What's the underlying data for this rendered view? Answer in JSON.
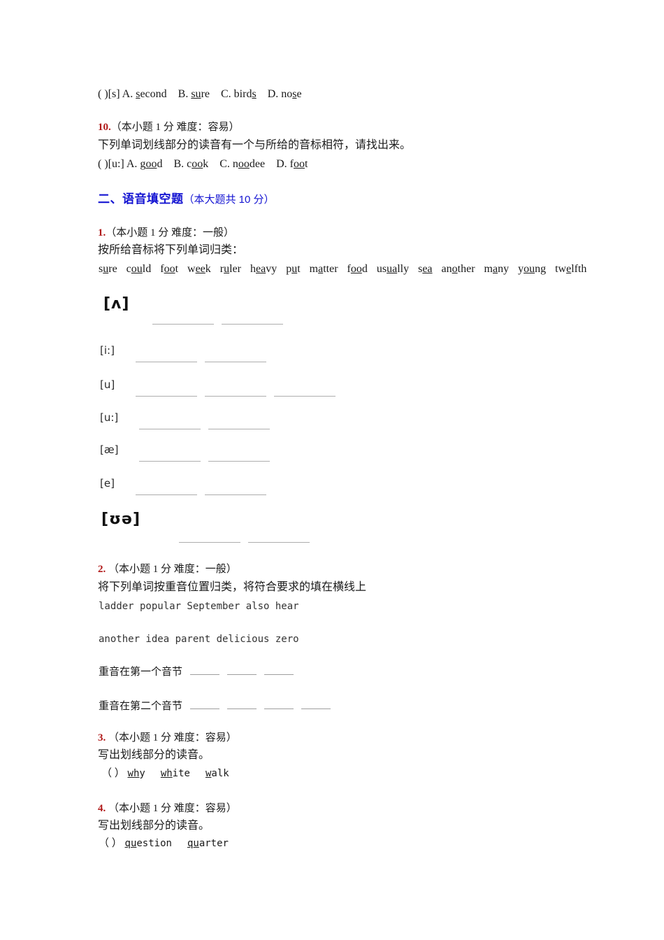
{
  "document": {
    "type": "english-phonetics-worksheet",
    "colors": {
      "question_number": "#b01818",
      "section_heading": "#1414d2",
      "body_text": "#1a1a1a",
      "blank_line": "#adadad"
    }
  },
  "top_choice_line": {
    "bracket": "(      )",
    "phonetic": "[s]",
    "choices": [
      {
        "label": "A.",
        "word_pre": "",
        "word_underlined": "s",
        "word_post": "econd"
      },
      {
        "label": "B.",
        "word_pre": "",
        "word_underlined": "su",
        "word_post": "re"
      },
      {
        "label": "C.",
        "word_pre": "bird",
        "word_underlined": "s",
        "word_post": ""
      },
      {
        "label": "D.",
        "word_pre": "no",
        "word_underlined": "s",
        "word_post": "e"
      }
    ]
  },
  "question_10": {
    "number": "10.",
    "meta": "（本小题 1 分 难度：容易）",
    "stem": "下列单词划线部分的读音有一个与所给的音标相符，请找出来。",
    "bracket": "(     )",
    "phonetic": "[u:]",
    "choices": [
      {
        "label": "A.",
        "word_pre": "g",
        "word_underlined": "oo",
        "word_post": "d"
      },
      {
        "label": "B.",
        "word_pre": "c",
        "word_underlined": "oo",
        "word_post": "k"
      },
      {
        "label": "C.",
        "word_pre": "n",
        "word_underlined": "oo",
        "word_post": "dee"
      },
      {
        "label": "D.",
        "word_pre": "f",
        "word_underlined": "oo",
        "word_post": "t"
      }
    ]
  },
  "section_two": {
    "title": "二、语音填空题",
    "points": "（本大题共 10 分）"
  },
  "question_1": {
    "number": "1.",
    "meta": "（本小题 1 分 难度：一般）",
    "stem": "按所给音标将下列单词归类：",
    "word_bank": [
      {
        "pre": "s",
        "u": "u",
        "post": "re"
      },
      {
        "pre": "c",
        "u": "ou",
        "post": "ld"
      },
      {
        "pre": "f",
        "u": "oo",
        "post": "t"
      },
      {
        "pre": "w",
        "u": "ee",
        "post": "k"
      },
      {
        "pre": "r",
        "u": "u",
        "post": "ler"
      },
      {
        "pre": "h",
        "u": "ea",
        "post": "vy"
      },
      {
        "pre": "p",
        "u": "u",
        "post": "t"
      },
      {
        "pre": "m",
        "u": "a",
        "post": "tter"
      },
      {
        "pre": "f",
        "u": "oo",
        "post": "d"
      },
      {
        "pre": "us",
        "u": "ua",
        "post": "lly"
      },
      {
        "pre": "s",
        "u": "ea",
        "post": ""
      },
      {
        "pre": "an",
        "u": "o",
        "post": "ther"
      },
      {
        "pre": "m",
        "u": "a",
        "post": "ny"
      },
      {
        "pre": "y",
        "u": "ou",
        "post": "ng"
      },
      {
        "pre": "tw",
        "u": "e",
        "post": "lfth"
      }
    ],
    "ipa_groups": [
      {
        "symbol": "[ʌ]",
        "big": true,
        "blanks": 2
      },
      {
        "symbol": "[i:]",
        "big": false,
        "blanks": 2
      },
      {
        "symbol": "[u]",
        "big": false,
        "blanks": 3
      },
      {
        "symbol": "[u:]",
        "big": false,
        "blanks": 2
      },
      {
        "symbol": "[æ]",
        "big": false,
        "blanks": 2
      },
      {
        "symbol": "[e]",
        "big": false,
        "blanks": 2
      },
      {
        "symbol": "[ʊə]",
        "big": true,
        "blanks": 2
      }
    ]
  },
  "question_2": {
    "number": "2.",
    "meta": "（本小题 1 分 难度：一般）",
    "stem": "将下列单词按重音位置归类，将符合要求的填在横线上",
    "word_line_1": "ladder    popular    September also    hear",
    "word_line_2": "another idea    parent    delicious    zero",
    "stress_1_label": "重音在第一个音节",
    "stress_1_blanks": 3,
    "stress_2_label": "重音在第二个音节",
    "stress_2_blanks": 4
  },
  "question_3": {
    "number": "3.",
    "meta": "（本小题 1 分 难度：容易）",
    "stem": "写出划线部分的读音。",
    "bracket": "（    ）",
    "words": [
      {
        "pre": "",
        "u": "wh",
        "post": "y"
      },
      {
        "pre": "",
        "u": "wh",
        "post": "ite"
      },
      {
        "pre": "",
        "u": "w",
        "post": "alk"
      }
    ]
  },
  "question_4": {
    "number": "4.",
    "meta": "（本小题 1 分 难度：容易）",
    "stem": "写出划线部分的读音。",
    "bracket": "（ ）",
    "words": [
      {
        "pre": "",
        "u": "qu",
        "post": "estion"
      },
      {
        "pre": "",
        "u": "qu",
        "post": "arter"
      }
    ]
  }
}
